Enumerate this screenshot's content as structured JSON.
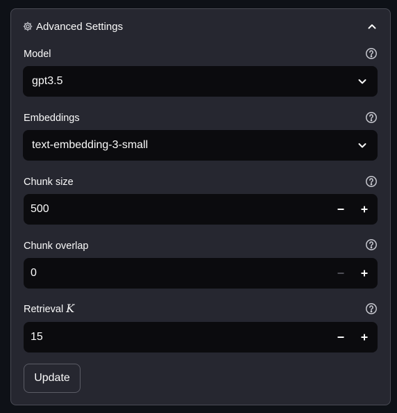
{
  "expander": {
    "title": "Advanced Settings",
    "icon": "gear-icon",
    "toggle_icon": "chevron-up-icon"
  },
  "fields": {
    "model": {
      "label": "Model",
      "value": "gpt3.5"
    },
    "embeddings": {
      "label": "Embeddings",
      "value": "text-embedding-3-small"
    },
    "chunk_size": {
      "label": "Chunk size",
      "value": "500"
    },
    "chunk_overlap": {
      "label": "Chunk overlap",
      "value": "0"
    },
    "retrieval_k": {
      "label": "Retrieval",
      "label_math": "K",
      "value": "15"
    }
  },
  "update_button": "Update",
  "colors": {
    "page_bg": "#0e1117",
    "panel_bg": "#262730",
    "input_bg": "#0b0b0e",
    "text": "#fafafa",
    "disabled": "#6b6c75"
  }
}
